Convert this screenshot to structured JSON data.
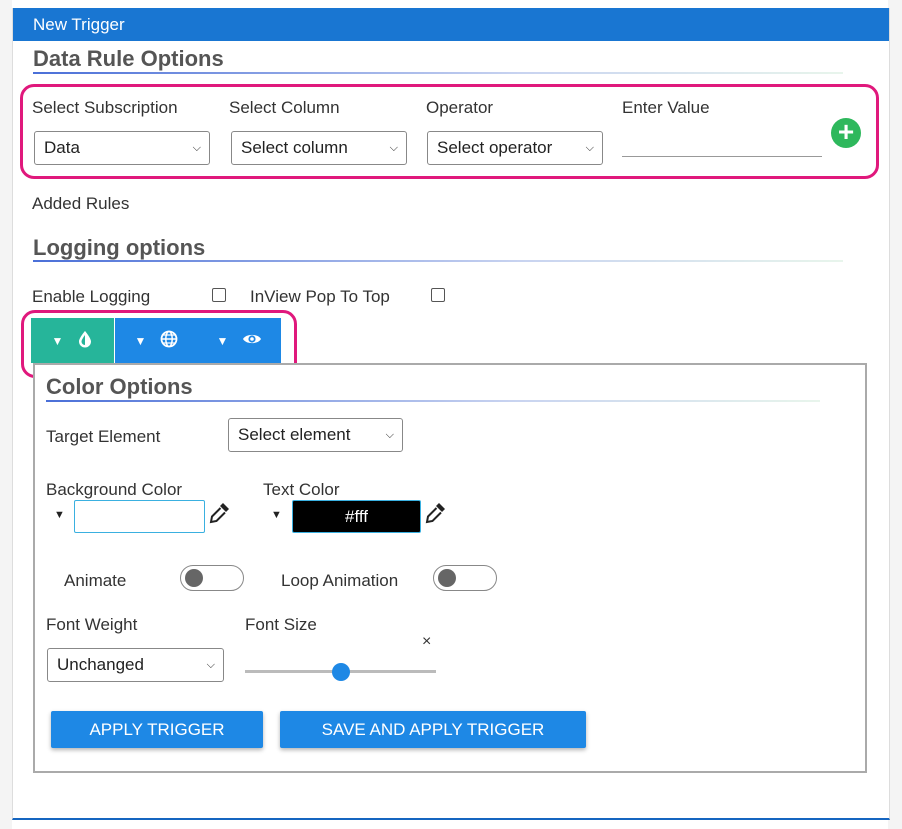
{
  "dialog": {
    "title": "New Trigger"
  },
  "data_rule": {
    "heading": "Data Rule Options",
    "subscription": {
      "label": "Select Subscription",
      "value": "Data"
    },
    "column": {
      "label": "Select Column",
      "value": "Select column"
    },
    "operator": {
      "label": "Operator",
      "value": "Select operator"
    },
    "value": {
      "label": "Enter Value",
      "input": ""
    },
    "add_icon": "plus-circle-icon"
  },
  "added_rules": {
    "label": "Added Rules"
  },
  "logging": {
    "heading": "Logging options",
    "enable_logging": {
      "label": "Enable Logging",
      "checked": false
    },
    "inview_pop": {
      "label": "InView Pop To Top",
      "checked": false
    }
  },
  "option_tabs": [
    {
      "icon": "droplet-icon",
      "color": "#26b59a"
    },
    {
      "icon": "globe-icon",
      "color": "#1e88e5"
    },
    {
      "icon": "eye-icon",
      "color": "#1e88e5"
    }
  ],
  "color_options": {
    "heading": "Color Options",
    "target_element": {
      "label": "Target Element",
      "value": "Select element"
    },
    "background_color": {
      "label": "Background Color",
      "value": ""
    },
    "text_color": {
      "label": "Text Color",
      "value": "#fff"
    },
    "animate": {
      "label": "Animate",
      "on": false
    },
    "loop_animation": {
      "label": "Loop Animation",
      "on": false
    },
    "font_weight": {
      "label": "Font Weight",
      "value": "Unchanged"
    },
    "font_size": {
      "label": "Font Size",
      "clear": "×",
      "slider_fraction": 0.5
    },
    "apply_button": "APPLY TRIGGER",
    "save_apply_button": "SAVE AND APPLY TRIGGER"
  },
  "colors": {
    "titlebar": "#1976d2",
    "highlight": "#e0187c",
    "add": "#2eb85c",
    "primary": "#1e88e5",
    "teal": "#26b59a"
  }
}
